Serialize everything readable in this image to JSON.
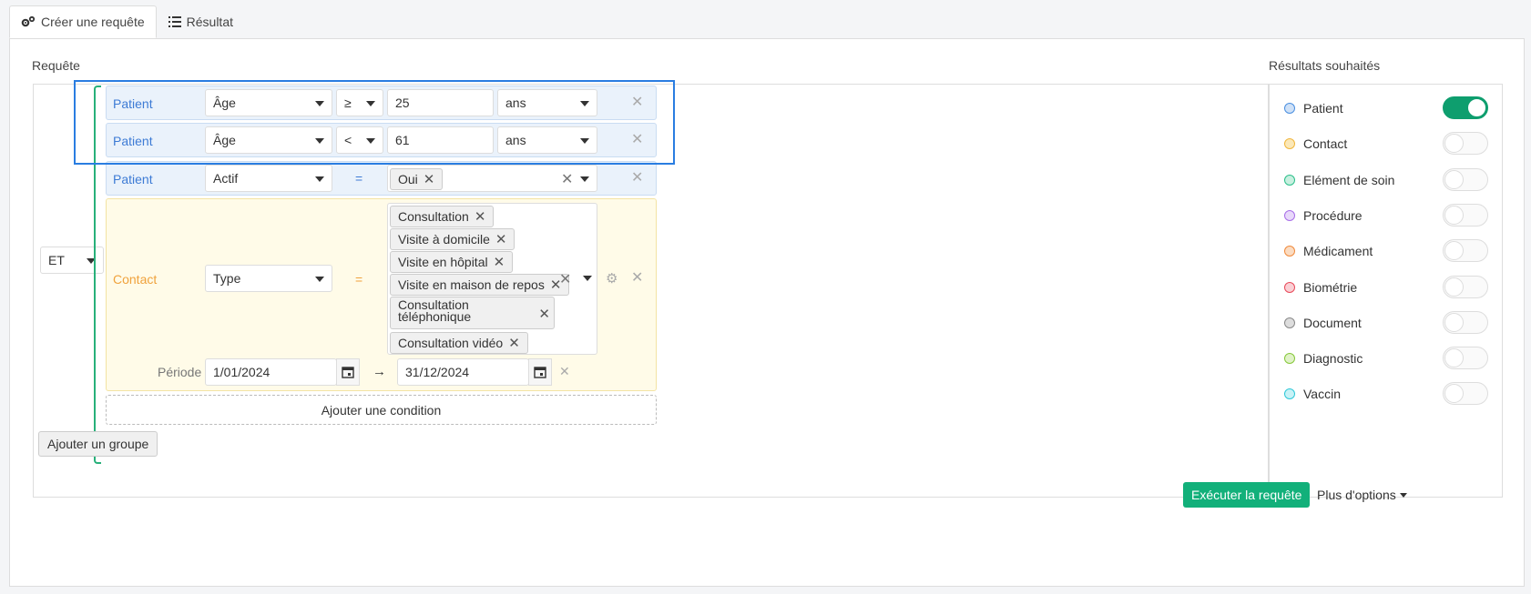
{
  "tabs": [
    {
      "label": "Créer une requête",
      "icon": "gears-icon"
    },
    {
      "label": "Résultat",
      "icon": "list-icon"
    }
  ],
  "query": {
    "title": "Requête",
    "group_operator": "ET",
    "rows": [
      {
        "entity": "Patient",
        "field": "Âge",
        "operator": "≥",
        "value": "25",
        "unit": "ans"
      },
      {
        "entity": "Patient",
        "field": "Âge",
        "operator": "<",
        "value": "61",
        "unit": "ans"
      },
      {
        "entity": "Patient",
        "field": "Actif",
        "operator": "=",
        "tags": [
          "Oui"
        ]
      },
      {
        "entity": "Contact",
        "field": "Type",
        "operator": "=",
        "tags": [
          "Consultation",
          "Visite à domicile",
          "Visite en hôpital",
          "Visite en maison de repos",
          "Consultation téléphonique",
          "Consultation vidéo"
        ],
        "period_label": "Période",
        "date_from": "1/01/2024",
        "date_to": "31/12/2024",
        "arrow": "→"
      }
    ],
    "add_condition": "Ajouter une condition",
    "add_group": "Ajouter un groupe"
  },
  "results": {
    "title": "Résultats souhaités",
    "items": [
      {
        "label": "Patient",
        "color": "#4a8fe0",
        "fill": "#cfe1f7",
        "on": true
      },
      {
        "label": "Contact",
        "color": "#f0b63c",
        "fill": "#fbe8b8",
        "on": false
      },
      {
        "label": "Elément de soin",
        "color": "#2cbf8a",
        "fill": "#c8f0e0",
        "on": false
      },
      {
        "label": "Procédure",
        "color": "#a86ee8",
        "fill": "#e8d8fa",
        "on": false
      },
      {
        "label": "Médicament",
        "color": "#f08a3c",
        "fill": "#fbdcc2",
        "on": false
      },
      {
        "label": "Biométrie",
        "color": "#e84a5a",
        "fill": "#fad0d5",
        "on": false
      },
      {
        "label": "Document",
        "color": "#888888",
        "fill": "#dddddd",
        "on": false
      },
      {
        "label": "Diagnostic",
        "color": "#86c83a",
        "fill": "#e0f2c8",
        "on": false
      },
      {
        "label": "Vaccin",
        "color": "#2ec8d8",
        "fill": "#c8f2f6",
        "on": false
      }
    ]
  },
  "actions": {
    "run": "Exécuter la requête",
    "more": "Plus d'options"
  }
}
